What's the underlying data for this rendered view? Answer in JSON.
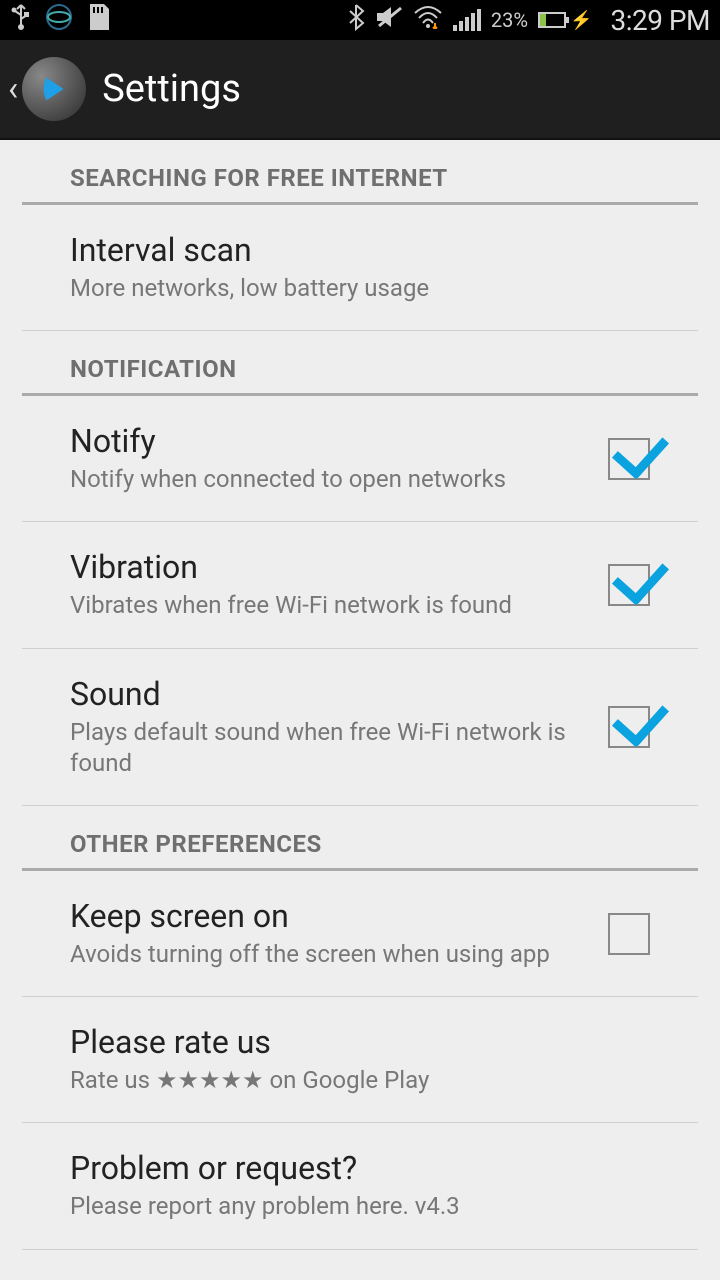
{
  "status": {
    "time": "3:29 PM",
    "battery_pct": "23%"
  },
  "header": {
    "title": "Settings"
  },
  "sections": {
    "search": {
      "label": "SEARCHING FOR FREE INTERNET",
      "interval": {
        "title": "Interval scan",
        "summary": "More networks, low battery usage"
      }
    },
    "notification": {
      "label": "NOTIFICATION",
      "notify": {
        "title": "Notify",
        "summary": "Notify when connected to open networks",
        "checked": true
      },
      "vibration": {
        "title": "Vibration",
        "summary": "Vibrates when free Wi-Fi network is found",
        "checked": true
      },
      "sound": {
        "title": "Sound",
        "summary": "Plays default sound when free Wi-Fi network is found",
        "checked": true
      }
    },
    "other": {
      "label": "OTHER PREFERENCES",
      "keep_screen": {
        "title": "Keep screen on",
        "summary": "Avoids turning off the screen when using app",
        "checked": false
      },
      "rate": {
        "title": "Please rate us",
        "summary": "Rate us ★★★★★ on Google Play"
      },
      "problem": {
        "title": "Problem or request?",
        "summary": "Please report any problem here. v4.3"
      }
    }
  }
}
